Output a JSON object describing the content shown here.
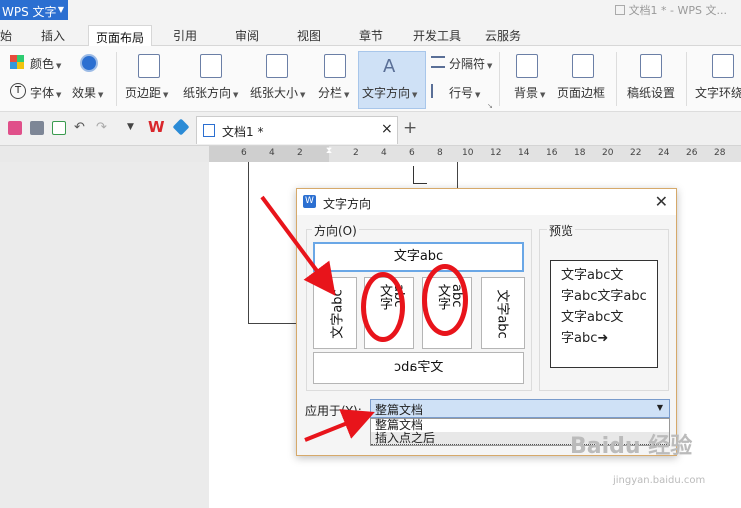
{
  "titlebar": {
    "app_name": "WPS 文字",
    "doc_title": "文档1 * - WPS 文..."
  },
  "tabs": [
    {
      "label": "始"
    },
    {
      "label": "插入"
    },
    {
      "label": "页面布局"
    },
    {
      "label": "引用"
    },
    {
      "label": "审阅"
    },
    {
      "label": "视图"
    },
    {
      "label": "章节"
    },
    {
      "label": "开发工具"
    },
    {
      "label": "云服务"
    }
  ],
  "ribbon": {
    "color": "颜色",
    "font": "字体",
    "effects": "效果",
    "margins": "页边距",
    "orientation": "纸张方向",
    "size": "纸张大小",
    "columns": "分栏",
    "text_direction": "文字方向",
    "breaks": "分隔符",
    "line_numbers": "行号",
    "background": "背景",
    "page_border": "页面边框",
    "grid_paper": "稿纸设置",
    "wrap": "文字环绕"
  },
  "doc_tab": {
    "label": "文档1 *",
    "close": "×",
    "new": "+"
  },
  "ruler": {
    "ticks": [
      "6",
      "4",
      "2",
      "2",
      "4",
      "6",
      "8",
      "10",
      "12",
      "14",
      "16",
      "18",
      "20",
      "22",
      "24",
      "26",
      "28"
    ]
  },
  "dialog": {
    "title": "文字方向",
    "direction_group": "方向(O)",
    "preview_group": "预览",
    "opt_horizontal": "文字abc",
    "opt_rotated_cw": "文字abc",
    "opt_v1_col1": "文字",
    "opt_v1_col2": "abc",
    "opt_v2_col1": "文字",
    "opt_v2_col2": "abc",
    "opt_rotated_ccw": "文字abc",
    "opt_mirrored": "文字abc",
    "preview_lines": [
      "文字abc文",
      "字abc文字abc",
      "文字abc文",
      "字abc➜"
    ],
    "apply_label": "应用于(Y):",
    "apply_value": "整篇文档",
    "apply_options": [
      "整篇文档",
      "插入点之后"
    ]
  },
  "watermark": {
    "text": "Baidu 经验",
    "sub": "jingyan.baidu.com"
  },
  "colors": {
    "accent": "#2b6fd1",
    "annotation": "#e8141b",
    "dialog_border": "#d6a96a"
  }
}
